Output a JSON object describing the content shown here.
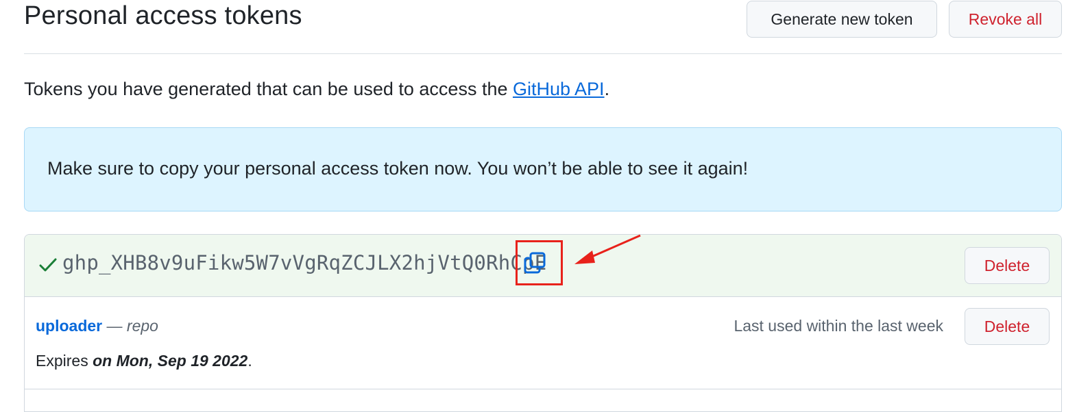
{
  "header": {
    "title": "Personal access tokens",
    "generate_label": "Generate new token",
    "revoke_all_label": "Revoke all"
  },
  "intro": {
    "text": "Tokens you have generated that can be used to access the ",
    "link_text": "GitHub API",
    "suffix": "."
  },
  "flash": {
    "message": "Make sure to copy your personal access token now. You won’t be able to see it again!"
  },
  "new_token": {
    "value": "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",
    "delete_label": "Delete"
  },
  "tokens": [
    {
      "name": "uploader",
      "separator": " — ",
      "scope": "repo",
      "last_used": "Last used within the last week",
      "expires_prefix": "Expires ",
      "expires_date": "on Mon, Sep 19 2022",
      "expires_suffix": ".",
      "delete_label": "Delete"
    }
  ],
  "colors": {
    "link": "#0969da",
    "danger": "#cf222e",
    "flash_bg": "#ddf4ff",
    "success_bg": "#eff8ef",
    "success_icon": "#1a7f37",
    "annotation": "#e8221b"
  },
  "icons": {
    "check": "check-icon",
    "copy": "copy-icon",
    "arrow": "annotation-arrow"
  }
}
